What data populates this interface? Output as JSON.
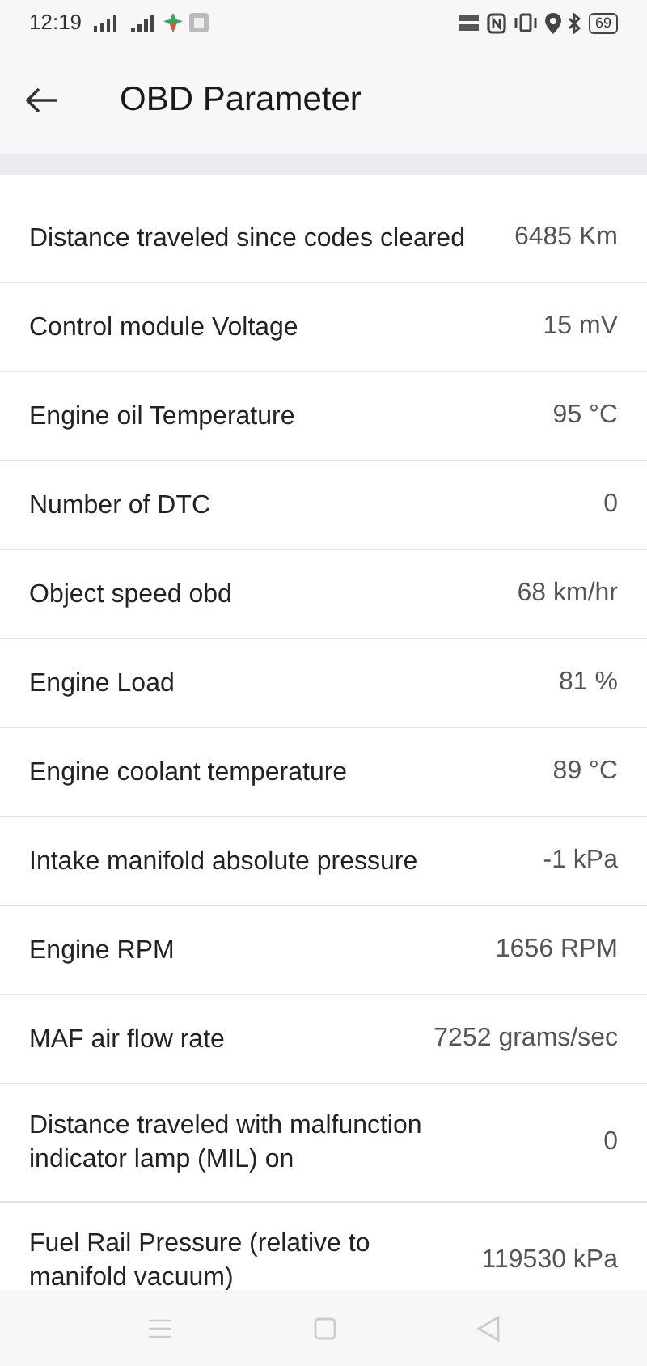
{
  "status_bar": {
    "time": "12:19",
    "battery": "69"
  },
  "header": {
    "title": "OBD Parameter"
  },
  "parameters": [
    {
      "name": "Distance traveled since codes cleared",
      "value": "6485 Km"
    },
    {
      "name": "Control module Voltage",
      "value": "15 mV"
    },
    {
      "name": "Engine oil Temperature",
      "value": "95 °C"
    },
    {
      "name": "Number of DTC",
      "value": "0"
    },
    {
      "name": "Object speed obd",
      "value": "68 km/hr"
    },
    {
      "name": "Engine Load",
      "value": "81 %"
    },
    {
      "name": "Engine coolant temperature",
      "value": "89 °C"
    },
    {
      "name": "Intake manifold absolute pressure",
      "value": "-1 kPa"
    },
    {
      "name": "Engine RPM",
      "value": "1656 RPM"
    },
    {
      "name": "MAF air flow rate",
      "value": "7252 grams/sec"
    },
    {
      "name": "Distance traveled with malfunction indicator lamp (MIL) on",
      "value": "0"
    },
    {
      "name": "Fuel Rail Pressure (relative to manifold vacuum)",
      "value": "119530 kPa"
    }
  ]
}
